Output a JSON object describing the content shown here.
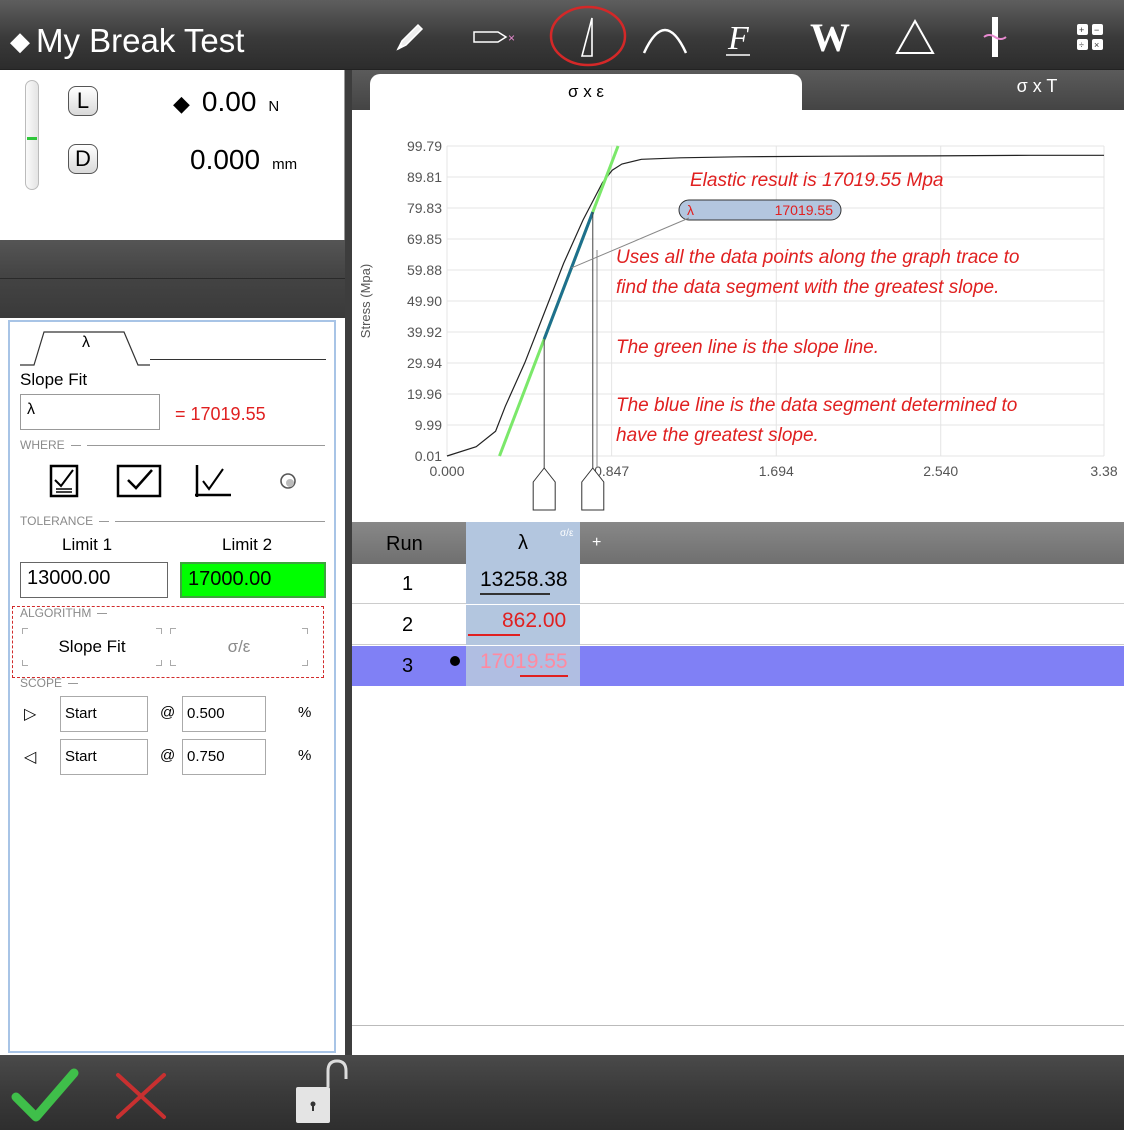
{
  "header": {
    "title": "My Break Test",
    "tools": [
      "pencil-icon",
      "arrow-marker-icon",
      "slope-icon",
      "peak-icon",
      "function-icon",
      "work-icon",
      "delta-icon",
      "break-icon",
      "calculator-icon"
    ]
  },
  "meter": {
    "load_key": "L",
    "load_value": "0.00",
    "load_unit": "N",
    "disp_key": "D",
    "disp_value": "0.000",
    "disp_unit": "mm"
  },
  "editor": {
    "tab_label": "λ",
    "section_title": "Slope Fit",
    "name_value": "λ",
    "result": "= 17019.55",
    "where_label": "WHERE",
    "tolerance_label": "TOLERANCE",
    "limit1_label": "Limit 1",
    "limit2_label": "Limit 2",
    "limit1_value": "13000.00",
    "limit2_value": "17000.00",
    "algorithm_label": "ALGORITHM",
    "algo_slope_fit": "Slope Fit",
    "algo_sigma_eps": "σ/ε",
    "scope_label": "SCOPE",
    "scope_rows": [
      {
        "ref": "Start",
        "at": "@",
        "value": "0.500",
        "unit": "%"
      },
      {
        "ref": "Start",
        "at": "@",
        "value": "0.750",
        "unit": "%"
      }
    ]
  },
  "tabs": {
    "active": "σ x ε",
    "inactive": "σ x T"
  },
  "chart_data": {
    "type": "line",
    "ylabel": "Stress (Mpa)",
    "xlabel": "",
    "y_ticks": [
      "99.79",
      "89.81",
      "79.83",
      "69.85",
      "59.88",
      "49.90",
      "39.92",
      "29.94",
      "19.96",
      "9.99",
      "0.01"
    ],
    "x_ticks": [
      "0.000",
      "0.847",
      "1.694",
      "2.540",
      "3.38"
    ],
    "ylim": [
      0.01,
      99.79
    ],
    "xlim": [
      0,
      3.38
    ],
    "series": [
      {
        "x": [
          0.0,
          0.15,
          0.25,
          0.3,
          0.4,
          0.5,
          0.6,
          0.7,
          0.8,
          0.85,
          0.9,
          1.0,
          1.2,
          1.5,
          2.0,
          2.5,
          3.0,
          3.38
        ],
        "y": [
          0.01,
          3,
          8,
          16,
          30,
          46,
          62,
          76,
          88,
          92,
          94,
          95.5,
          96,
          96.3,
          96.5,
          96.6,
          96.8,
          96.8
        ]
      }
    ],
    "slope_line": {
      "x": [
        0.27,
        0.88
      ],
      "y": [
        0.01,
        99.79
      ]
    },
    "segment_start_x": 0.5,
    "segment_end_x": 0.75,
    "label_box": {
      "name": "λ",
      "value": "17019.55"
    },
    "grid": true
  },
  "annotations": [
    "Elastic result is 17019.55 Mpa",
    "Uses all the data points along the graph trace to",
    "find the data segment with the greatest slope.",
    "The green line is the slope line.",
    "The blue line is the data segment determined to",
    "have the greatest slope."
  ],
  "table": {
    "col_run": "Run",
    "col_lambda": "λ",
    "col_sub": "σ/ε",
    "col_add": "+",
    "rows": [
      {
        "run": "1",
        "value": "13258.38",
        "color": "#000000"
      },
      {
        "run": "2",
        "value": "862.00",
        "color": "#e02020"
      },
      {
        "run": "3",
        "value": "17019.55",
        "color": "#ff8aa0"
      }
    ]
  },
  "colors": {
    "slope_line": "#7be86a",
    "segment": "#1e6f8e",
    "annotation": "#e02020",
    "selected_row": "#8080f5",
    "limit2_bg": "#00ff00"
  }
}
